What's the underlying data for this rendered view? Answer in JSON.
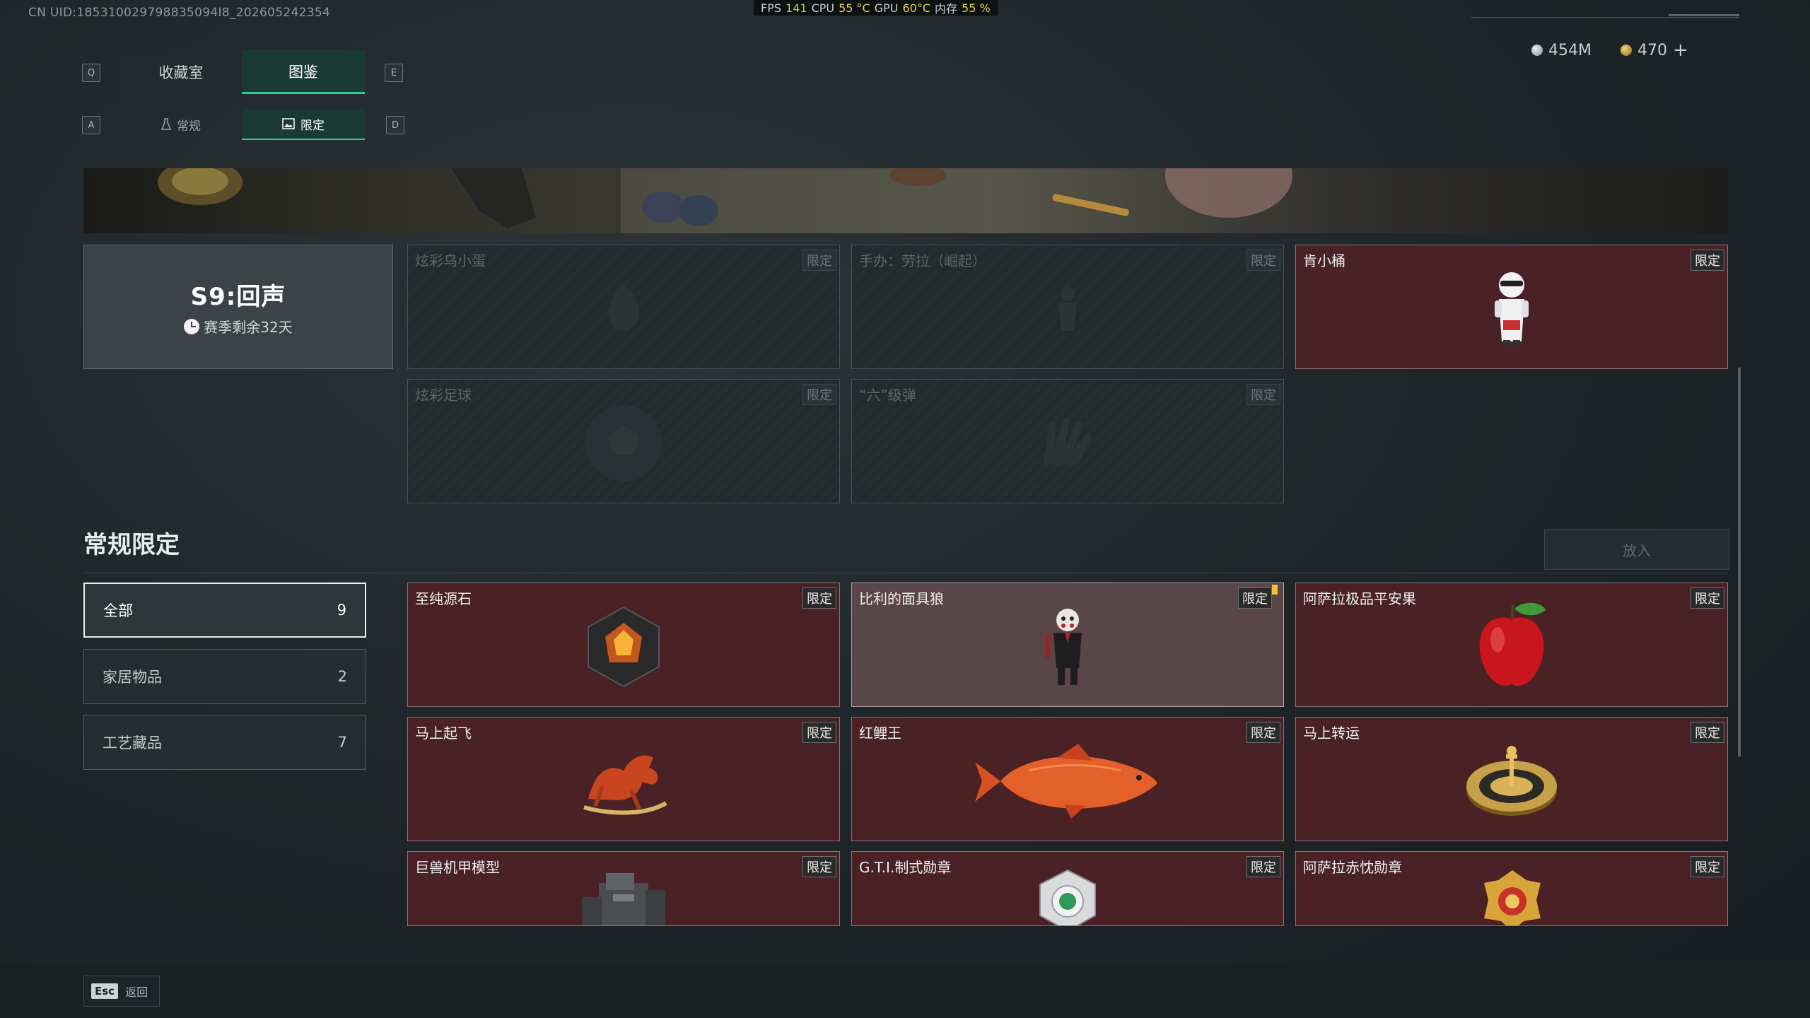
{
  "overlay": {
    "uid": "CN UID:185310029798835094I8_202605242354",
    "perf": {
      "fps_label": "FPS",
      "fps": "141",
      "cpu_label": "CPU",
      "cpu": "55 °C",
      "gpu_label": "GPU",
      "gpu": "60°C",
      "mem_label": "内存",
      "mem": "55 %"
    }
  },
  "currency": {
    "silver": "454M",
    "gold": "470",
    "plus": "+"
  },
  "tabs": {
    "left_key": "Q",
    "right_key": "E",
    "items": [
      {
        "label": "收藏室"
      },
      {
        "label": "图鉴"
      }
    ]
  },
  "subtabs": {
    "left_key": "A",
    "right_key": "D",
    "items": [
      {
        "label": "常规"
      },
      {
        "label": "限定"
      }
    ]
  },
  "season": {
    "title": "S9:回声",
    "remaining": "赛季剩余32天"
  },
  "season_items": [
    {
      "name": "炫彩乌小蛋",
      "tag": "限定"
    },
    {
      "name": "手办：劳拉（崛起）",
      "tag": "限定"
    },
    {
      "name": "肯小桶",
      "tag": "限定"
    },
    {
      "name": "炫彩足球",
      "tag": "限定"
    },
    {
      "name": "“六”级弹",
      "tag": "限定"
    }
  ],
  "section": {
    "title": "常规限定",
    "put_in": "放入"
  },
  "filters": [
    {
      "label": "全部",
      "count": "9"
    },
    {
      "label": "家居物品",
      "count": "2"
    },
    {
      "label": "工艺藏品",
      "count": "7"
    }
  ],
  "items": [
    {
      "name": "至纯源石",
      "tag": "限定",
      "icon": "gem-icon"
    },
    {
      "name": "比利的面具狼",
      "tag": "限定",
      "icon": "puppet-icon"
    },
    {
      "name": "阿萨拉极品平安果",
      "tag": "限定",
      "icon": "apple-icon"
    },
    {
      "name": "马上起飞",
      "tag": "限定",
      "icon": "horse-icon"
    },
    {
      "name": "红鲤王",
      "tag": "限定",
      "icon": "fish-icon"
    },
    {
      "name": "马上转运",
      "tag": "限定",
      "icon": "roulette-icon"
    },
    {
      "name": "巨兽机甲模型",
      "tag": "限定",
      "icon": "mech-icon"
    },
    {
      "name": "G.T.I.制式勋章",
      "tag": "限定",
      "icon": "medal-icon"
    },
    {
      "name": "阿萨拉赤忱勋章",
      "tag": "限定",
      "icon": "badge-icon"
    }
  ],
  "footer": {
    "esc": "Esc",
    "back": "返回"
  },
  "colors": {
    "accent": "#37c78f",
    "card_red": "#4a2226",
    "card_selected": "#5a4548"
  }
}
